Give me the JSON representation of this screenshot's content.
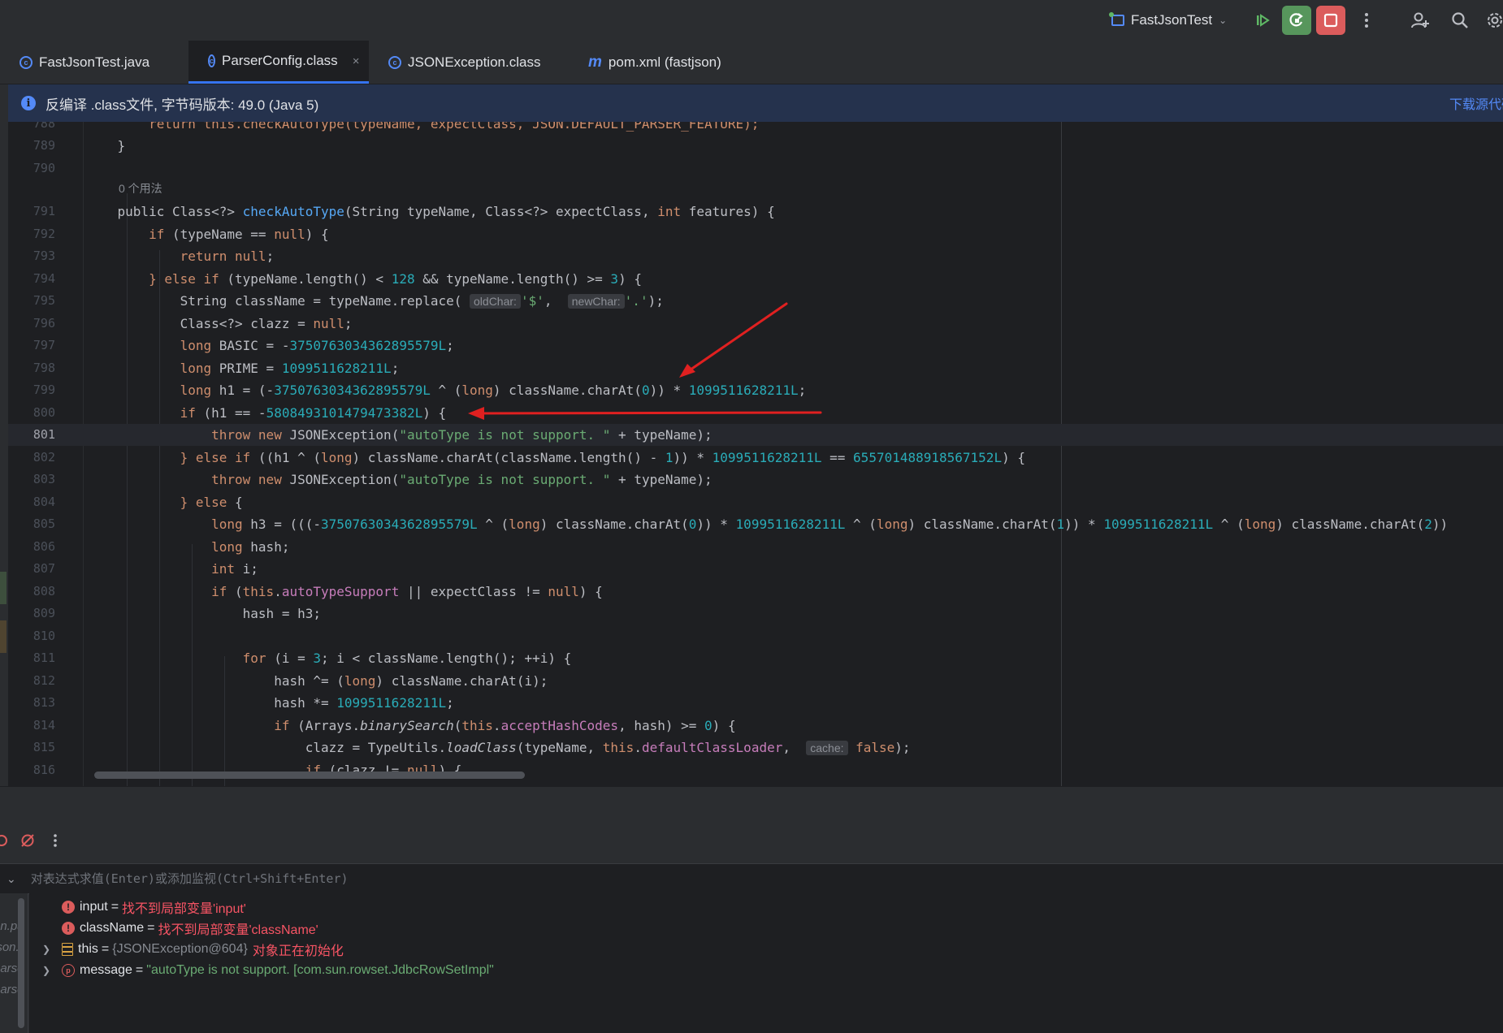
{
  "toolbar": {
    "run_config": "FastJsonTest",
    "buttons": [
      "resume",
      "rerun",
      "stop",
      "more",
      "add-user",
      "search",
      "settings"
    ]
  },
  "tabs": [
    {
      "label": "FastJsonTest.java",
      "icon": "class-icon",
      "active": false
    },
    {
      "label": "ParserConfig.class",
      "icon": "class-icon",
      "active": true,
      "close": "×"
    },
    {
      "label": "JSONException.class",
      "icon": "class-icon",
      "active": false
    },
    {
      "label": "pom.xml (fastjson)",
      "icon": "maven-icon",
      "active": false
    }
  ],
  "banner": {
    "text": "反编译 .class文件, 字节码版本: 49.0 (Java 5)",
    "link": "下载源代码"
  },
  "editor": {
    "usage_hint": "0 个用法",
    "current_line": "801",
    "lines": [
      {
        "n": "788"
      },
      {
        "n": "789"
      },
      {
        "n": "790"
      },
      {
        "n": "791"
      },
      {
        "n": "792"
      },
      {
        "n": "793"
      },
      {
        "n": "794"
      },
      {
        "n": "795"
      },
      {
        "n": "796"
      },
      {
        "n": "797"
      },
      {
        "n": "798"
      },
      {
        "n": "799"
      },
      {
        "n": "800"
      },
      {
        "n": "801"
      },
      {
        "n": "802"
      },
      {
        "n": "803"
      },
      {
        "n": "804"
      },
      {
        "n": "805"
      },
      {
        "n": "806"
      },
      {
        "n": "807"
      },
      {
        "n": "808"
      },
      {
        "n": "809"
      },
      {
        "n": "810"
      },
      {
        "n": "811"
      },
      {
        "n": "812"
      },
      {
        "n": "813"
      },
      {
        "n": "814"
      },
      {
        "n": "815"
      },
      {
        "n": "816"
      }
    ],
    "code": {
      "l788": "        return this.checkAutoType(typeName, expectClass, JSON.DEFAULT_PARSER_FEATURE);",
      "l789": "    }",
      "l791a": "    public Class<?> ",
      "l791b": "checkAutoType",
      "l791c": "(String typeName, Class<?> expectClass, ",
      "l791d": "int",
      "l791e": " features) {",
      "l792a": "        if",
      "l792b": " (typeName == ",
      "l792c": "null",
      "l792d": ") {",
      "l793a": "            return null",
      "l793b": ";",
      "l794a": "        } else if",
      "l794b": " (typeName.length() < ",
      "l794c": "128",
      "l794d": " && typeName.length() >= ",
      "l794e": "3",
      "l794f": ") {",
      "l795a": "            String className = typeName.replace( ",
      "l795hint1": "oldChar:",
      "l795b": "'$'",
      "l795c": ",  ",
      "l795hint2": "newChar:",
      "l795d": "'.'",
      "l795e": ");",
      "l796a": "            Class<?> clazz = ",
      "l796b": "null",
      "l796c": ";",
      "l797a": "            long",
      "l797b": " BASIC = -",
      "l797c": "3750763034362895579L",
      "l797d": ";",
      "l798a": "            long",
      "l798b": " PRIME = ",
      "l798c": "1099511628211L",
      "l798d": ";",
      "l799a": "            long",
      "l799b": " h1 = (-",
      "l799c": "3750763034362895579L",
      "l799d": " ^ (",
      "l799e": "long",
      "l799f": ") className.charAt(",
      "l799g": "0",
      "l799h": ")) * ",
      "l799i": "1099511628211L",
      "l799j": ";",
      "l800a": "            if",
      "l800b": " (h1 == -",
      "l800c": "5808493101479473382L",
      "l800d": ") {",
      "l801a": "                throw new",
      "l801b": " JSONException(",
      "l801c": "\"autoType is not support. \"",
      "l801d": " + typeName);",
      "l802a": "            } else if",
      "l802b": " ((h1 ^ (",
      "l802c": "long",
      "l802d": ") className.charAt(className.length() - ",
      "l802e": "1",
      "l802f": ")) * ",
      "l802g": "1099511628211L",
      "l802h": " == ",
      "l802i": "655701488918567152L",
      "l802j": ") {",
      "l803a": "                throw new",
      "l803b": " JSONException(",
      "l803c": "\"autoType is not support. \"",
      "l803d": " + typeName);",
      "l804a": "            } else",
      "l804b": " {",
      "l805a": "                long",
      "l805b": " h3 = (((-",
      "l805c": "3750763034362895579L",
      "l805d": " ^ (",
      "l805e": "long",
      "l805f": ") className.charAt(",
      "l805g": "0",
      "l805h": ")) * ",
      "l805i": "1099511628211L",
      "l805j": " ^ (",
      "l805k": "long",
      "l805l": ") className.charAt(",
      "l805m": "1",
      "l805n": ")) * ",
      "l805o": "1099511628211L",
      "l805p": " ^ (",
      "l805q": "long",
      "l805r": ") className.charAt(",
      "l805s": "2",
      "l805t": "))",
      "l806a": "                long",
      "l806b": " hash;",
      "l807a": "                int",
      "l807b": " i;",
      "l808a": "                if",
      "l808b": " (",
      "l808c": "this",
      "l808d": ".",
      "l808e": "autoTypeSupport",
      "l808f": " || expectClass != ",
      "l808g": "null",
      "l808h": ") {",
      "l809": "                    hash = h3;",
      "l811a": "                    for",
      "l811b": " (i = ",
      "l811c": "3",
      "l811d": "; i < className.length(); ++i) {",
      "l812a": "                        hash ^= (",
      "l812b": "long",
      "l812c": ") className.charAt(i);",
      "l813a": "                        hash *= ",
      "l813b": "1099511628211L",
      "l813c": ";",
      "l814a": "                        if",
      "l814b": " (Arrays.",
      "l814c": "binarySearch",
      "l814d": "(",
      "l814e": "this",
      "l814f": ".",
      "l814g": "acceptHashCodes",
      "l814h": ", hash) >= ",
      "l814i": "0",
      "l814j": ") {",
      "l815a": "                            clazz = TypeUtils.",
      "l815b": "loadClass",
      "l815c": "(typeName, ",
      "l815d": "this",
      "l815e": ".",
      "l815f": "defaultClassLoader",
      "l815g": ",  ",
      "l815hint": "cache:",
      "l815h": " false",
      "l815i": ");",
      "l816a": "                            if",
      "l816b": " (clazz != ",
      "l816c": "null",
      "l816d": ") {"
    }
  },
  "debug": {
    "eval_placeholder": "对表达式求值(Enter)或添加监视(Ctrl+Shift+Enter)",
    "frames": [
      "on.pa",
      "json.",
      "parse",
      "parse"
    ],
    "variables": [
      {
        "name": "input",
        "eq": "=",
        "value": "找不到局部变量'input'",
        "kind": "error"
      },
      {
        "name": "className",
        "eq": "=",
        "value": "找不到局部变量'className'",
        "kind": "error"
      },
      {
        "name": "this",
        "eq": "=",
        "value": "{JSONException@604}",
        "note": "对象正在初始化",
        "kind": "field"
      },
      {
        "name": "message",
        "eq": "=",
        "value": "\"autoType is not support. [com.sun.rowset.JdbcRowSetImpl\"",
        "kind": "param"
      }
    ]
  },
  "colors": {
    "background": "#1e1f22",
    "panel": "#2b2d30",
    "accent": "#3574f0",
    "keyword": "#cf8e6d",
    "number": "#2aacb8",
    "string": "#6aab73",
    "method": "#56a8f5",
    "field": "#c77dbb",
    "error": "#f75464",
    "arrow": "#e02020"
  }
}
